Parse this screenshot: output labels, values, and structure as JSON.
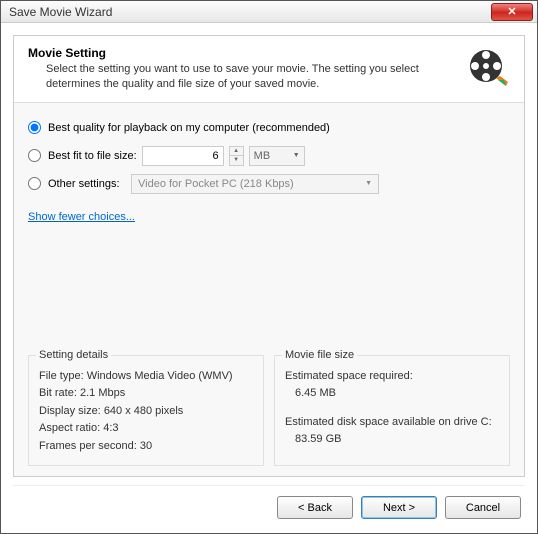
{
  "window": {
    "title": "Save Movie Wizard"
  },
  "header": {
    "title": "Movie Setting",
    "description": "Select the setting you want to use to save your movie. The setting you select determines the quality and file size of your saved movie."
  },
  "options": {
    "best_quality": {
      "label": "Best quality for playback on my computer (recommended)",
      "selected": true
    },
    "best_fit": {
      "label": "Best fit to file size:",
      "value": "6",
      "unit": "MB",
      "selected": false
    },
    "other": {
      "label": "Other settings:",
      "value": "Video for Pocket PC (218 Kbps)",
      "selected": false
    }
  },
  "link": {
    "label": "Show fewer choices..."
  },
  "details": {
    "title": "Setting details",
    "file_type_label": "File type:",
    "file_type": "Windows Media Video (WMV)",
    "bit_rate_label": "Bit rate:",
    "bit_rate": "2.1 Mbps",
    "display_size_label": "Display size:",
    "display_size": "640 x 480 pixels",
    "aspect_ratio_label": "Aspect ratio:",
    "aspect_ratio": "4:3",
    "fps_label": "Frames per second:",
    "fps": "30"
  },
  "filesize": {
    "title": "Movie file size",
    "required_label": "Estimated space required:",
    "required": "6.45 MB",
    "available_label": "Estimated disk space available on drive C:",
    "available": "83.59 GB"
  },
  "buttons": {
    "back": "< Back",
    "next": "Next >",
    "cancel": "Cancel"
  }
}
